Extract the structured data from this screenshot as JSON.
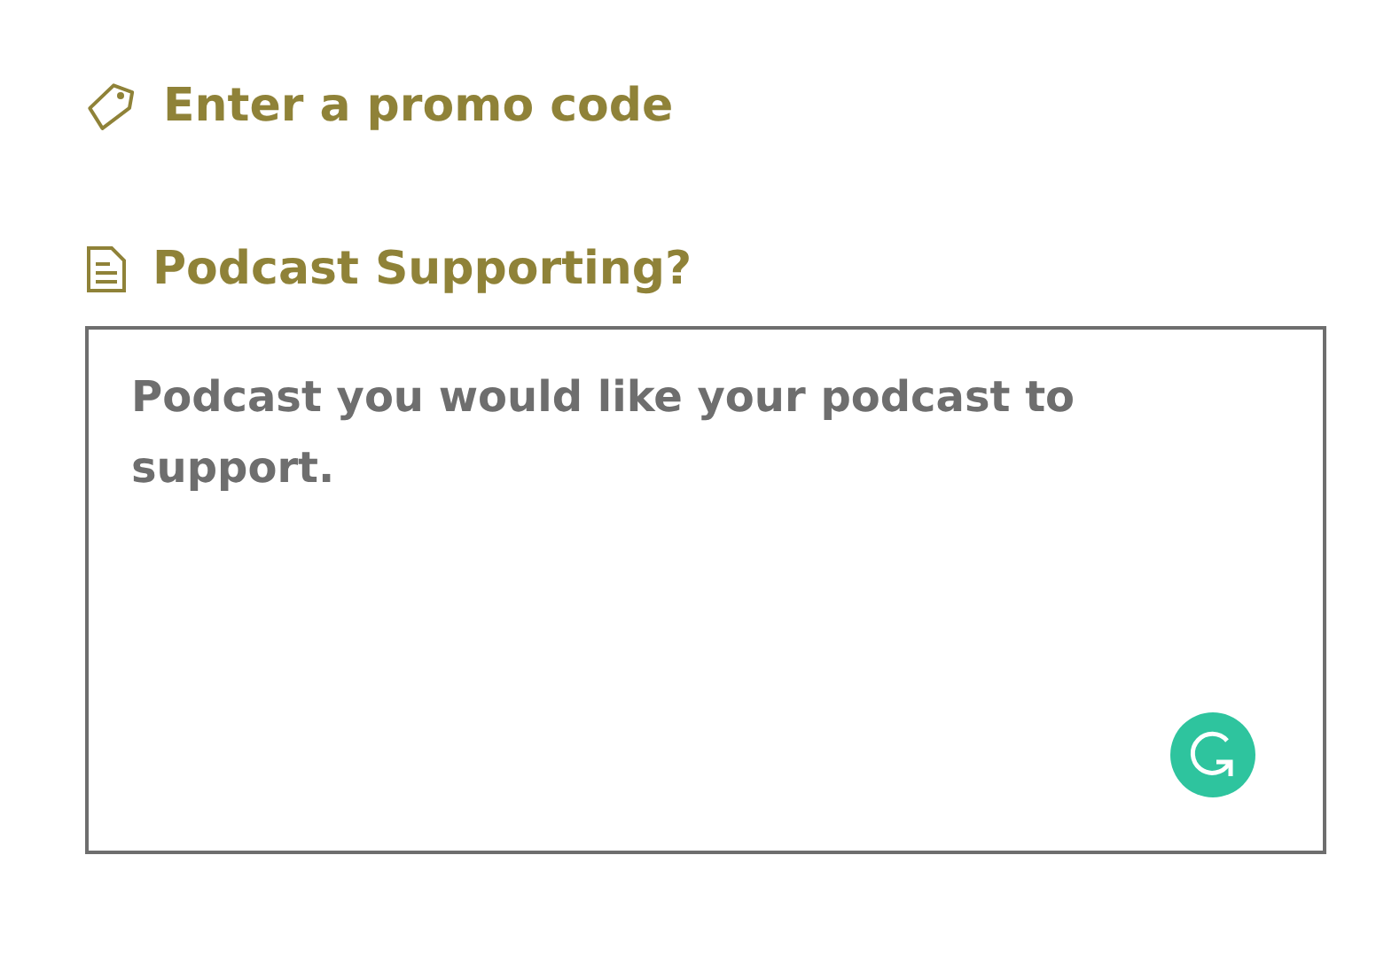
{
  "promo": {
    "label": "Enter a promo code"
  },
  "podcast": {
    "label": "Podcast Supporting?",
    "placeholder": "Podcast you would like your podcast to support."
  }
}
